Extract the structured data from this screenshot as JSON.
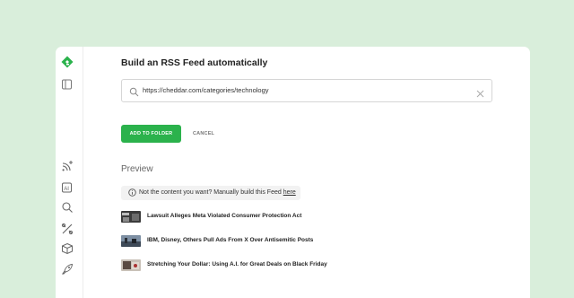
{
  "rail": {
    "icons": [
      "feedly-logo",
      "sidebar-toggle-icon",
      "add-feed-icon",
      "ai-feed-icon",
      "search-icon",
      "tools-icon",
      "box-icon",
      "rocket-icon"
    ]
  },
  "header": {
    "title": "Build an RSS Feed automatically"
  },
  "search": {
    "value": "https://cheddar.com/categories/technology"
  },
  "actions": {
    "add_label": "ADD TO FOLDER",
    "cancel_label": "CANCEL"
  },
  "preview": {
    "heading": "Preview",
    "notice_text": "Not the content you want? Manually build this Feed ",
    "notice_link": "here",
    "articles": [
      {
        "headline": "Lawsuit Alleges Meta Violated Consumer Protection Act"
      },
      {
        "headline": "IBM, Disney, Others Pull Ads From X Over Antisemitic Posts"
      },
      {
        "headline": "Stretching Your Dollar: Using A.I. for Great Deals on Black Friday"
      }
    ]
  },
  "colors": {
    "accent": "#2bb24c",
    "background": "#d9eedb"
  }
}
